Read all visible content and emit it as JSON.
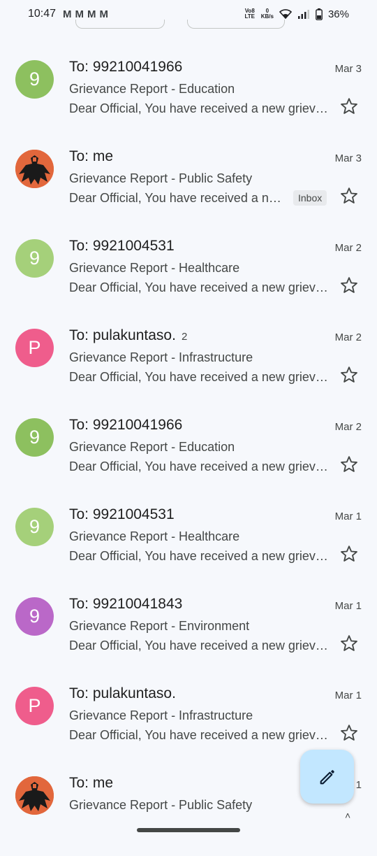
{
  "status": {
    "time": "10:47",
    "mail_icons": [
      "M",
      "M",
      "M",
      "M"
    ],
    "volte": "Vo8 LTE",
    "speed_value": "0",
    "speed_unit": "KB/s",
    "battery": "36%"
  },
  "emails": [
    {
      "avatar": "9",
      "avatar_color": "#8dc05f",
      "sender": "To: 99210041966",
      "count": "",
      "date": "Mar 3",
      "subject": "Grievance Report - Education",
      "snippet": "Dear Official, You have received a new grievance",
      "label": ""
    },
    {
      "avatar": "",
      "avatar_color": "#e2673c",
      "sender": "To: me",
      "count": "",
      "date": "Mar 3",
      "subject": "Grievance Report - Public Safety",
      "snippet": "Dear Official, You have received a new grievance",
      "label": "Inbox"
    },
    {
      "avatar": "9",
      "avatar_color": "#a5d07a",
      "sender": "To: 9921004531",
      "count": "",
      "date": "Mar 2",
      "subject": "Grievance Report - Healthcare",
      "snippet": "Dear Official, You have received a new grievance",
      "label": ""
    },
    {
      "avatar": "P",
      "avatar_color": "#ef5d8c",
      "sender": "To: pulakuntaso.",
      "count": "2",
      "date": "Mar 2",
      "subject": "Grievance Report - Infrastructure",
      "snippet": "Dear Official, You have received a new grievance",
      "label": ""
    },
    {
      "avatar": "9",
      "avatar_color": "#8dc05f",
      "sender": "To: 99210041966",
      "count": "",
      "date": "Mar 2",
      "subject": "Grievance Report - Education",
      "snippet": "Dear Official, You have received a new grievance",
      "label": ""
    },
    {
      "avatar": "9",
      "avatar_color": "#a5d07a",
      "sender": "To: 9921004531",
      "count": "",
      "date": "Mar 1",
      "subject": "Grievance Report - Healthcare",
      "snippet": "Dear Official, You have received a new grievance",
      "label": ""
    },
    {
      "avatar": "9",
      "avatar_color": "#ba68c8",
      "sender": "To: 99210041843",
      "count": "",
      "date": "Mar 1",
      "subject": "Grievance Report - Environment",
      "snippet": "Dear Official, You have received a new grievance",
      "label": ""
    },
    {
      "avatar": "P",
      "avatar_color": "#ef5d8c",
      "sender": "To: pulakuntaso.",
      "count": "",
      "date": "Mar 1",
      "subject": "Grievance Report - Infrastructure",
      "snippet": "Dear Official, You have received a new grievance",
      "label": ""
    },
    {
      "avatar": "",
      "avatar_color": "#e2673c",
      "sender": "To: me",
      "count": "",
      "date": "1",
      "subject": "Grievance Report - Public Safety",
      "snippet": "",
      "label": ""
    }
  ],
  "fab": {
    "icon": "pencil-icon",
    "color": "#c2e7ff"
  }
}
